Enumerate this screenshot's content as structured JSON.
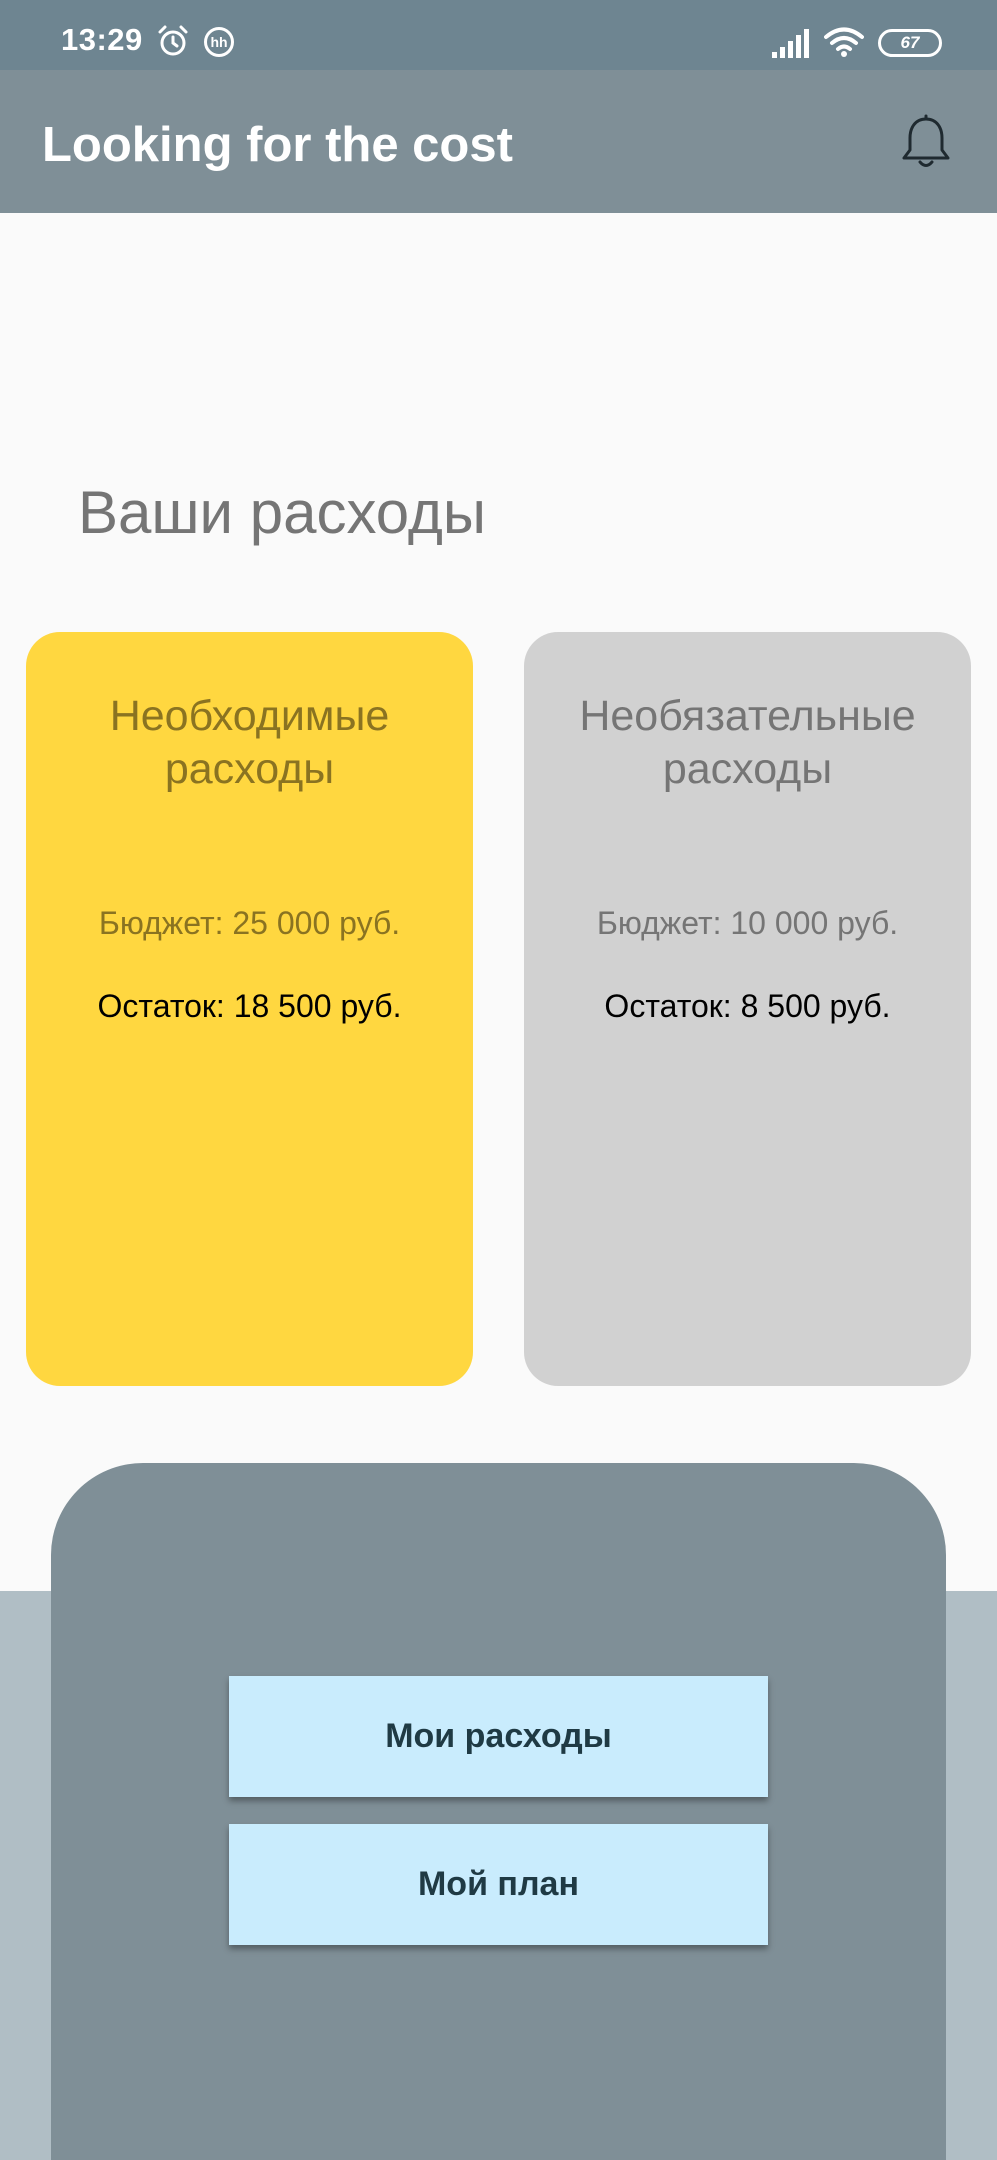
{
  "status_bar": {
    "time": "13:29",
    "notification_badge": "hh",
    "battery_level": "67",
    "icons": [
      "alarm-icon",
      "hh-app-icon",
      "signal-icon",
      "wifi-icon",
      "battery-icon"
    ]
  },
  "app_bar": {
    "title": "Looking for the cost",
    "action_icon": "bell-icon"
  },
  "main": {
    "section_title": "Ваши расходы",
    "cards": [
      {
        "title": "Необходимые расходы",
        "budget": "Бюджет: 25 000 руб.",
        "remainder": "Остаток: 18 500 руб.",
        "color": "#ffd740"
      },
      {
        "title": "Необязательные расходы",
        "budget": "Бюджет: 10 000 руб.",
        "remainder": "Остаток: 8 500 руб.",
        "color": "#d1d1d1"
      }
    ]
  },
  "bottom_panel": {
    "buttons": [
      {
        "label": "Мои расходы"
      },
      {
        "label": "Мой план"
      }
    ]
  },
  "colors": {
    "status_bar": "#6e8591",
    "app_bar": "#7f8f97",
    "panel": "#7f8f97",
    "strip": "#b0bec5",
    "button": "#c9ecfd"
  }
}
